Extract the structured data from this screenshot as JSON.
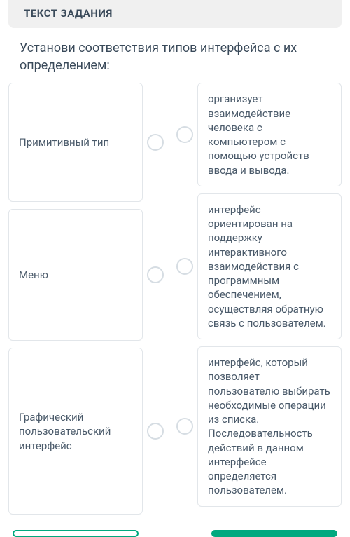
{
  "header": {
    "title": "ТЕКСТ ЗАДАНИЯ"
  },
  "question": "Установи соответствия типов интерфейса с их определением:",
  "left_items": [
    {
      "label": "Примитивный тип"
    },
    {
      "label": "Меню"
    },
    {
      "label": "Графический пользовательский интерфейс"
    }
  ],
  "right_items": [
    {
      "text": "организует взаимодействие человека с компьютером с помощью устройств ввода и вывода."
    },
    {
      "text": "интерфейс ориентирован на поддержку интерактивного взаимодействия с программным обеспечением, осуществляя обратную связь с пользователем."
    },
    {
      "text": "интерфейс, который позволяет пользователю выбирать необходимые операции из списка. Последовательность действий в данном интерфейсе определяется пользователем."
    }
  ]
}
